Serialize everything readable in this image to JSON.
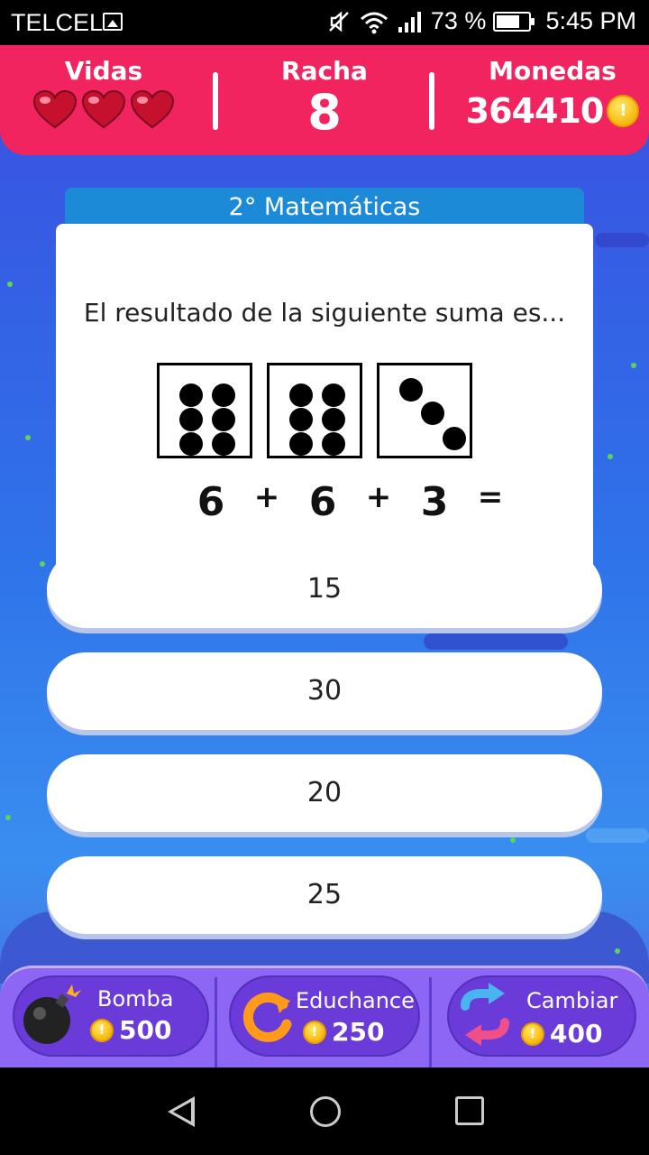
{
  "status_bar": {
    "carrier": "TELCEL",
    "battery_percent": "73 %",
    "battery_level": 0.73,
    "time": "5:45 PM"
  },
  "header": {
    "lives": {
      "label": "Vidas",
      "count": 3
    },
    "streak": {
      "label": "Racha",
      "value": "8"
    },
    "coins": {
      "label": "Monedas",
      "value": "364410"
    }
  },
  "question": {
    "subject": "2°  Matemáticas",
    "text": "El resultado de la siguiente suma es...",
    "dice_values": [
      6,
      6,
      3
    ],
    "equation": [
      "6",
      "+",
      "6",
      "+",
      "3",
      "="
    ]
  },
  "answers": [
    "15",
    "30",
    "20",
    "25"
  ],
  "powerups": [
    {
      "name": "Bomba",
      "cost": "500",
      "icon": "bomb-icon"
    },
    {
      "name": "Educhance",
      "cost": "250",
      "icon": "refresh-icon"
    },
    {
      "name": "Cambiar",
      "cost": "400",
      "icon": "swap-icon"
    }
  ],
  "colors": {
    "header": "#f2245f",
    "subject_tab": "#1d8ad8",
    "powerbar": "#8d66f5",
    "coin": "#f6b80d"
  }
}
